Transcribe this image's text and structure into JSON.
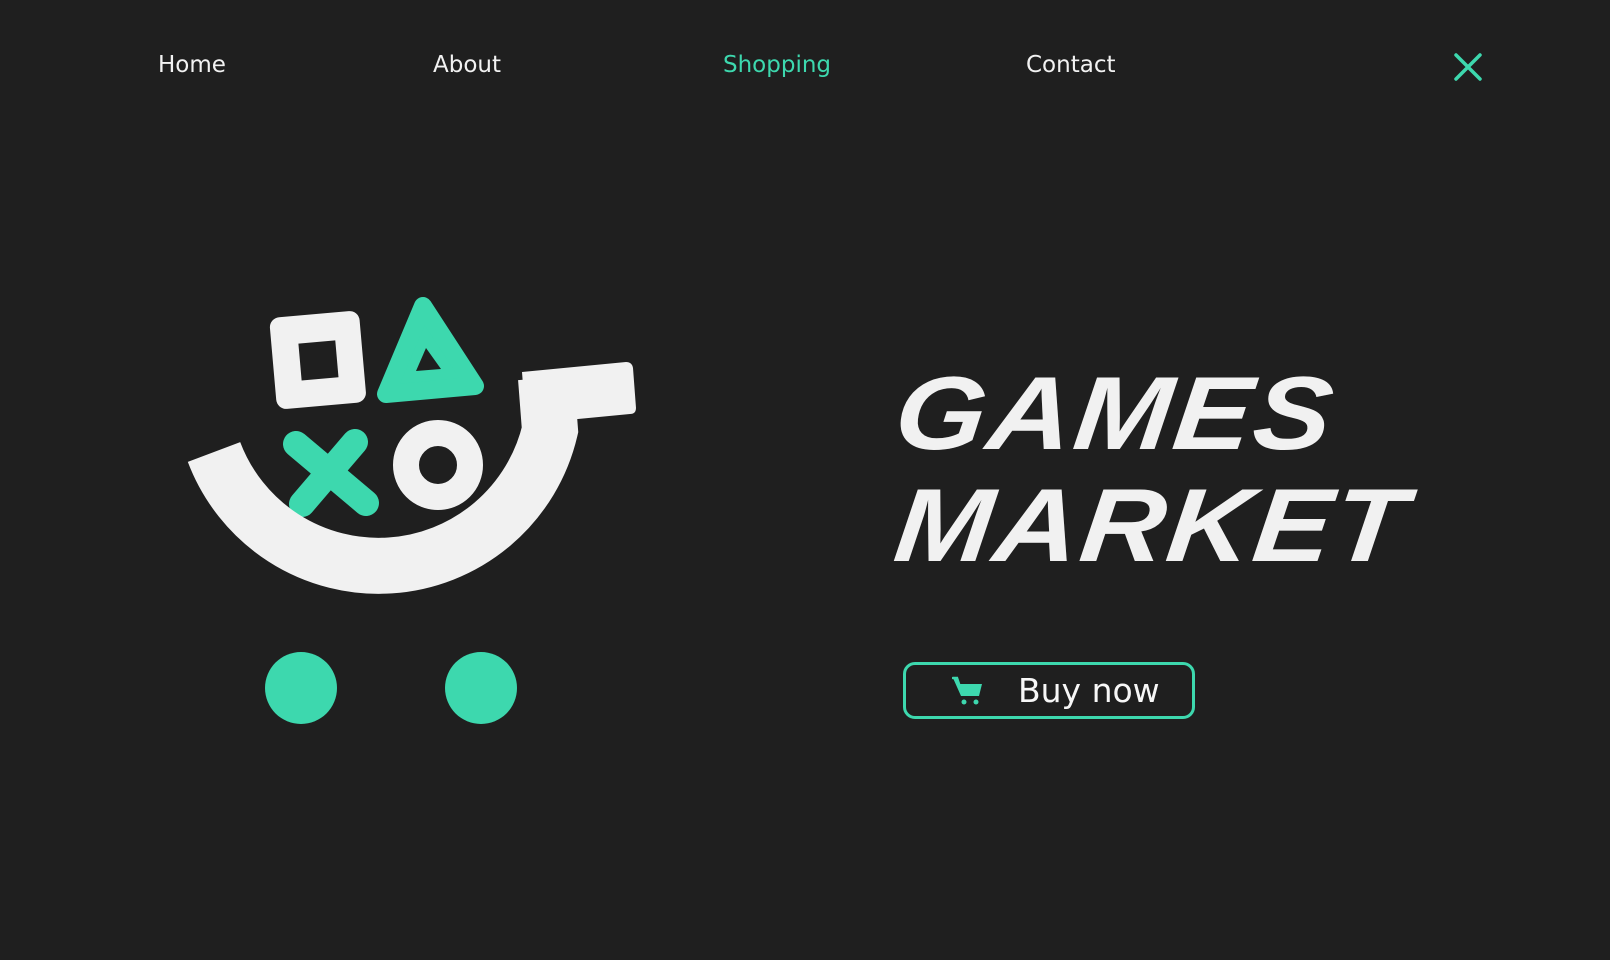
{
  "nav": {
    "items": [
      {
        "label": "Home",
        "active": false
      },
      {
        "label": "About",
        "active": false
      },
      {
        "label": "Shopping",
        "active": true
      },
      {
        "label": "Contact",
        "active": false
      }
    ],
    "close_icon": "close-x-icon"
  },
  "hero": {
    "title_line1": "GAMES",
    "title_line2": "MARKET",
    "logo_icon": "game-cart-logo",
    "buy_button": {
      "label": "Buy now",
      "icon": "cart-icon"
    }
  },
  "colors": {
    "background": "#1f1f1f",
    "accent": "#3dd8ae",
    "text": "#f1f1f1"
  }
}
